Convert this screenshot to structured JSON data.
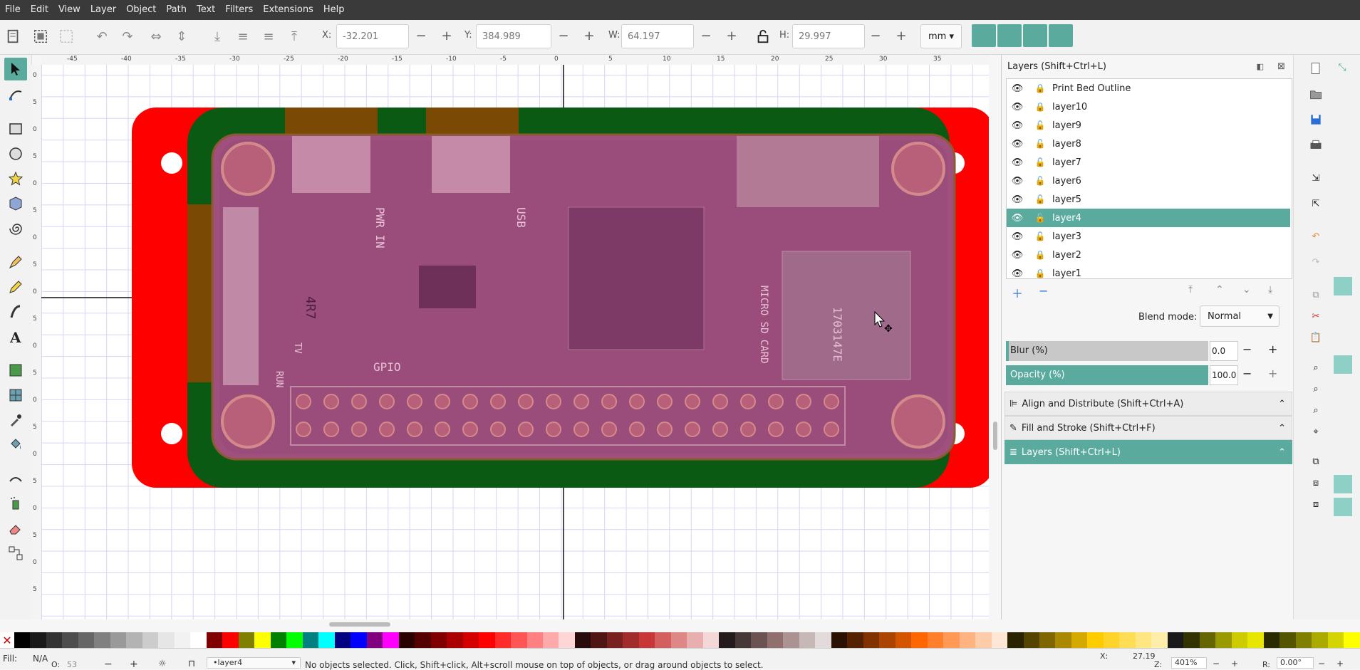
{
  "menu": [
    "File",
    "Edit",
    "View",
    "Layer",
    "Object",
    "Path",
    "Text",
    "Filters",
    "Extensions",
    "Help"
  ],
  "toolbar": {
    "x_label": "X:",
    "x_value": "-32.201",
    "y_label": "Y:",
    "y_value": "384.989",
    "w_label": "W:",
    "w_value": "64.197",
    "h_label": "H:",
    "h_value": "29.997",
    "units": "mm"
  },
  "ruler_h_labels": [
    "-45",
    "-40",
    "-35",
    "-30",
    "-25",
    "-20",
    "-15",
    "-10",
    "-5",
    "0",
    "5",
    "10",
    "15",
    "20",
    "25",
    "30",
    "35"
  ],
  "ruler_v_labels": [
    "0",
    "5",
    "0",
    "5",
    "0",
    "5",
    "0",
    "5",
    "0",
    "5",
    "0",
    "5",
    "0",
    "5",
    "0",
    "5",
    "0",
    "5",
    "0",
    "5"
  ],
  "canvas": {
    "silkscreen": {
      "pwr_in": "PWR IN",
      "usb": "USB",
      "gpio": "GPIO",
      "run": "RUN",
      "tv": "TV",
      "ic": "4R7",
      "micro_sd": "MICRO SD CARD",
      "chip": "1703147E"
    }
  },
  "layers_panel": {
    "title": "Layers (Shift+Ctrl+L)",
    "layers": [
      {
        "name": "Print Bed Outline",
        "locked": true
      },
      {
        "name": "layer10",
        "locked": true
      },
      {
        "name": "layer9",
        "locked": false
      },
      {
        "name": "layer8",
        "locked": false
      },
      {
        "name": "layer7",
        "locked": false
      },
      {
        "name": "layer6",
        "locked": false
      },
      {
        "name": "layer5",
        "locked": false
      },
      {
        "name": "layer4",
        "locked": false,
        "selected": true
      },
      {
        "name": "layer3",
        "locked": false
      },
      {
        "name": "layer2",
        "locked": true
      },
      {
        "name": "layer1",
        "locked": true
      }
    ],
    "blend_label": "Blend mode:",
    "blend_value": "Normal",
    "blur_label": "Blur (%)",
    "blur_value": "0.0",
    "opacity_label": "Opacity (%)",
    "opacity_value": "100.0"
  },
  "docked_panels": [
    "Align and Distribute (Shift+Ctrl+A)",
    "Fill and Stroke (Shift+Ctrl+F)",
    "Layers (Shift+Ctrl+L)"
  ],
  "status": {
    "fill_label": "Fill:",
    "fill_value": "N/A",
    "opacity_short": "O:",
    "opacity_num": "53",
    "current_layer": "•layer4",
    "message": "No objects selected. Click, Shift+click, Alt+scroll mouse on top of objects, or drag around objects to select.",
    "x_label": "X:",
    "x_value": "27.19",
    "z_label": "Z:",
    "zoom_value": "401%",
    "r_label": "R:",
    "rotation_value": "0.00°"
  },
  "palette": [
    "#000000",
    "#1a1a1a",
    "#333333",
    "#4d4d4d",
    "#666666",
    "#808080",
    "#999999",
    "#b3b3b3",
    "#cccccc",
    "#e6e6e6",
    "#f2f2f2",
    "#ffffff",
    "#800000",
    "#ff0000",
    "#808000",
    "#ffff00",
    "#008000",
    "#00ff00",
    "#008080",
    "#00ffff",
    "#000080",
    "#0000ff",
    "#800080",
    "#ff00ff",
    "#2b0000",
    "#550000",
    "#800000",
    "#aa0000",
    "#d40000",
    "#ff0000",
    "#ff2a2a",
    "#ff5555",
    "#ff8080",
    "#ffaaaa",
    "#ffd5d5",
    "#280b0b",
    "#501616",
    "#782121",
    "#a02c2c",
    "#c83737",
    "#d35f5f",
    "#de8787",
    "#e9afaf",
    "#f4d7d7",
    "#241c1c",
    "#483737",
    "#6c5353",
    "#916f6f",
    "#ac9393",
    "#c8b7b7",
    "#e3dbdb",
    "#2b1100",
    "#552200",
    "#803300",
    "#aa4400",
    "#d45500",
    "#ff6600",
    "#ff7f2a",
    "#ff9955",
    "#ffb380",
    "#ffccaa",
    "#ffe6d5",
    "#2b2200",
    "#554400",
    "#806600",
    "#aa8800",
    "#d4aa00",
    "#ffcc00",
    "#ffd42a",
    "#ffdd55",
    "#ffe680",
    "#ffeeaa",
    "#1a1a1a",
    "#333300",
    "#666600",
    "#999900",
    "#cccc00",
    "#e6e600",
    "#2b2b00",
    "#555500",
    "#808000",
    "#aaaa00",
    "#d4d400",
    "#ffff00"
  ],
  "colors": {
    "accent": "#5aab9e",
    "board_red": "#ff0000",
    "board_green": "#0b5a14",
    "board_brown": "#7a4a05",
    "pcb_overlay": "#b05a8a"
  }
}
